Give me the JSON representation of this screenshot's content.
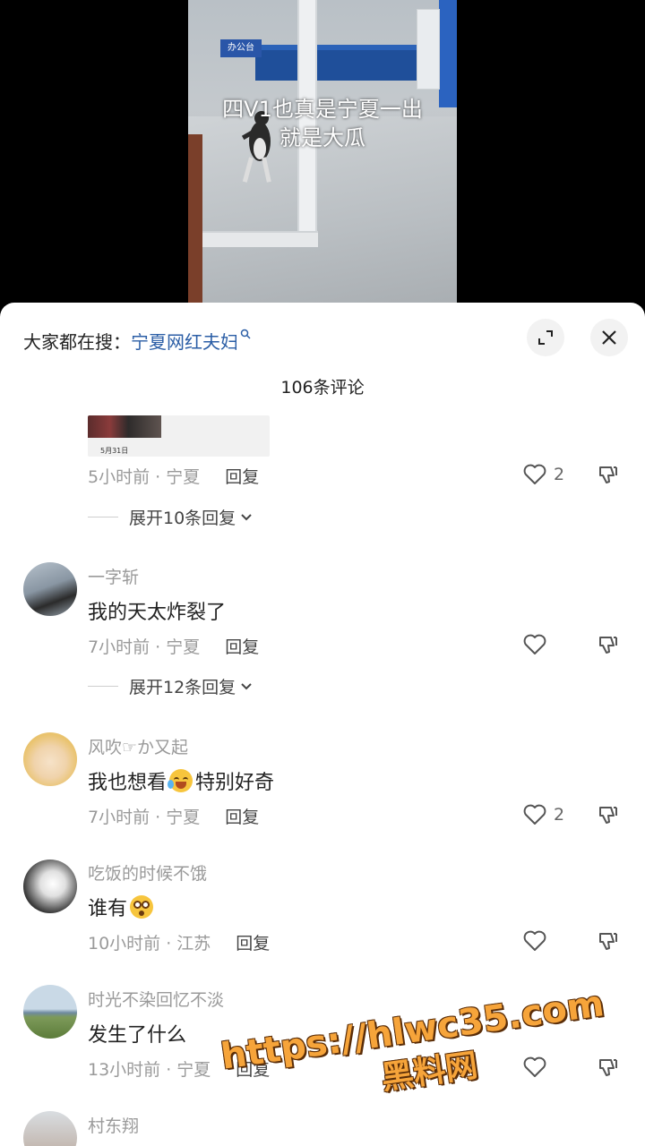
{
  "video": {
    "caption_line1": "四V1也真是宁夏一出",
    "caption_line2": "就是大瓜",
    "counter_label": "办公台"
  },
  "sheet": {
    "search_prefix": "大家都在搜：",
    "search_term": "宁夏网红夫妇",
    "comment_count": "106条评论",
    "expand_icon": "expand-icon",
    "close_icon": "close-icon"
  },
  "comments": [
    {
      "image_date": "5月31日",
      "time": "5小时前 · 宁夏",
      "reply": "回复",
      "likes": "2",
      "expand": "展开10条回复"
    },
    {
      "user": "一字斩",
      "text": "我的天太炸裂了",
      "time": "7小时前 · 宁夏",
      "reply": "回复",
      "likes": "",
      "expand": "展开12条回复"
    },
    {
      "user": "风吹☞か又起",
      "text_before": "我也想看",
      "text_after": "特别好奇",
      "time": "7小时前 · 宁夏",
      "reply": "回复",
      "likes": "2"
    },
    {
      "user": "吃饭的时候不饿",
      "text": "谁有",
      "time": "10小时前 · 江苏",
      "reply": "回复",
      "likes": ""
    },
    {
      "user": "时光不染回忆不淡",
      "text": "发生了什么",
      "time": "13小时前 · 宁夏",
      "reply": "回复",
      "likes": ""
    },
    {
      "user": "村东翔"
    }
  ],
  "watermark": {
    "url": "https://hlwc35.com",
    "name": "黑料网"
  },
  "colors": {
    "accent": "#2b5ea6",
    "watermark": "#f6a43a"
  }
}
